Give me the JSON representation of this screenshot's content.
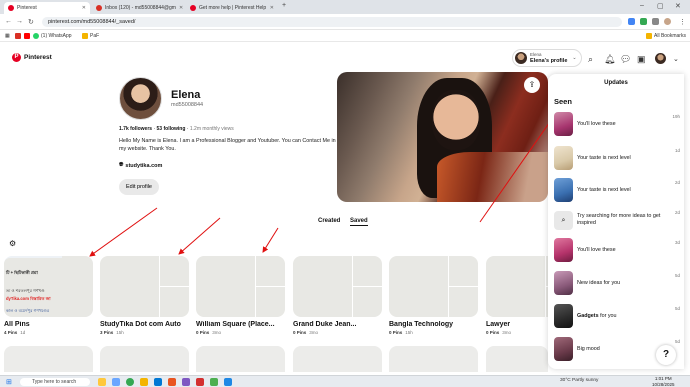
{
  "browser": {
    "tabs": [
      {
        "label": "Pinterest",
        "active": true,
        "color": "#e60023"
      },
      {
        "label": "Inbox (120) - md55008844@gm",
        "active": false,
        "color": "#d93025"
      },
      {
        "label": "Get more help | Pinterest Help",
        "active": false,
        "color": "#e60023"
      }
    ],
    "url": "pinterest.com/md55008844/_saved/",
    "bookmarks": [
      "(1) WhatsApp",
      "PaF"
    ],
    "all_bookmarks": "All Bookmarks"
  },
  "header": {
    "logo_text": "Pinterest",
    "profile_switch_small": "Elena",
    "profile_switch_name": "Elena's profile"
  },
  "profile": {
    "name": "Elena",
    "handle": "md55008844",
    "followers": "1.7k followers",
    "following": "53 following",
    "monthly_views": "1.2m monthly views",
    "bio": "Hello My Name is Elena. I am a Professional Blogger and Youtuber. You can Contact Me in my website. Thank You.",
    "website": "studytika.com",
    "edit_label": "Edit profile"
  },
  "tabs": {
    "created": "Created",
    "saved": "Saved"
  },
  "boards": [
    {
      "title": "All Pins",
      "pins": "4 Pins",
      "time": "1d"
    },
    {
      "title": "StudyTika Dot com Auto",
      "pins": "3 Pins",
      "time": "15h"
    },
    {
      "title": "William Square (Place...",
      "pins": "0 Pins",
      "time": "3mo"
    },
    {
      "title": "Grand Duke Jean...",
      "pins": "0 Pins",
      "time": "3mo"
    },
    {
      "title": "Bangla Technology",
      "pins": "0 Pins",
      "time": "15h"
    },
    {
      "title": "Lawyer",
      "pins": "0 Pins",
      "time": "3mo"
    }
  ],
  "allpins_preview": {
    "line1": "টি + ছিটিকাকী প্রশ্না",
    "line2": "ত্য ও শরতলপুর গণখণ্ড",
    "line3": "dyTika.com বিস্তারিত জা",
    "line4": "কাল ও বয়ের্দপুর গণখণ্ডের"
  },
  "updates": {
    "title": "Updates",
    "seen": "Seen",
    "items": [
      {
        "text": "You'll love these",
        "bold": "",
        "time": "19h",
        "color": "#a7356f"
      },
      {
        "text": "Your taste is next level",
        "bold": "",
        "time": "1d",
        "color": "#d9c9a8"
      },
      {
        "text": "Your taste is next level",
        "bold": "",
        "time": "2d",
        "color": "#3a6fb0"
      },
      {
        "text": "Try searching for more ideas to get inspired",
        "bold": "",
        "time": "2d",
        "color": "#e8e8e8"
      },
      {
        "text": "You'll love these",
        "bold": "",
        "time": "3d",
        "color": "#b5336b"
      },
      {
        "text": "New ideas for you",
        "bold": "",
        "time": "5d",
        "color": "#8a5a7a"
      },
      {
        "text": " for you",
        "bold": "Gadgets",
        "time": "5d",
        "color": "#2a2a2a"
      },
      {
        "text": "Big mood",
        "bold": "",
        "time": "5d",
        "color": "#6a3a4a"
      }
    ]
  },
  "taskbar": {
    "search_placeholder": "Type here to search",
    "weather": "30°C  Partly sunny",
    "time": "1:01 PM",
    "date": "10/28/2025"
  }
}
